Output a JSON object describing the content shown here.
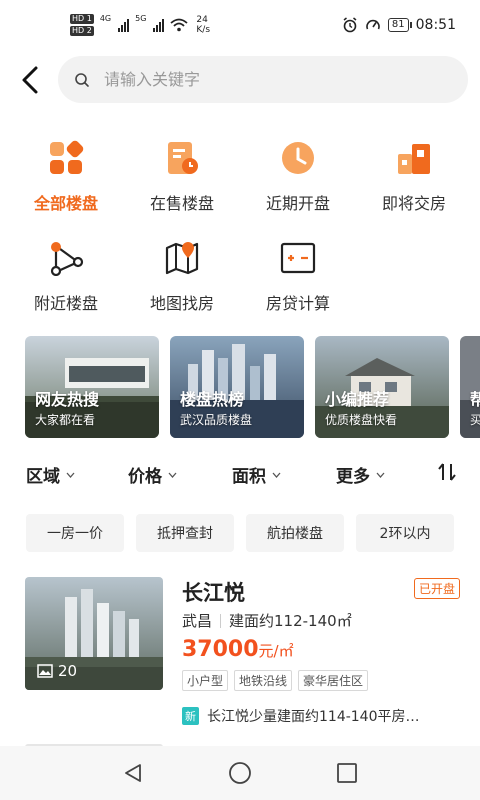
{
  "status_bar": {
    "hd1": "HD 1",
    "hd2": "HD 2",
    "net1": "4G",
    "net2": "5G",
    "speed_value": "24",
    "speed_unit": "K/s",
    "battery": "81",
    "time": "08:51"
  },
  "search": {
    "placeholder": "请输入关键字"
  },
  "categories": [
    {
      "label": "全部楼盘",
      "icon": "grid-icon",
      "active": true
    },
    {
      "label": "在售楼盘",
      "icon": "document-clock-icon",
      "active": false
    },
    {
      "label": "近期开盘",
      "icon": "clock-icon",
      "active": false
    },
    {
      "label": "即将交房",
      "icon": "buildings-icon",
      "active": false
    },
    {
      "label": "附近楼盘",
      "icon": "location-network-icon",
      "active": false
    },
    {
      "label": "地图找房",
      "icon": "map-pin-icon",
      "active": false
    },
    {
      "label": "房贷计算",
      "icon": "calculator-icon",
      "active": false
    }
  ],
  "banners": [
    {
      "title": "网友热搜",
      "subtitle": "大家都在看"
    },
    {
      "title": "楼盘热榜",
      "subtitle": "武汉品质楼盘"
    },
    {
      "title": "小编推荐",
      "subtitle": "优质楼盘快看"
    },
    {
      "title": "帮",
      "subtitle": "买"
    }
  ],
  "filters": [
    {
      "label": "区域"
    },
    {
      "label": "价格"
    },
    {
      "label": "面积"
    },
    {
      "label": "更多"
    }
  ],
  "chips": [
    "一房一价",
    "抵押查封",
    "航拍楼盘",
    "2环以内"
  ],
  "listing": {
    "name": "长江悦",
    "status": "已开盘",
    "district": "武昌",
    "area": "建面约112-140㎡",
    "price": "37000",
    "price_unit": "元/㎡",
    "tags": [
      "小户型",
      "地铁沿线",
      "豪华居住区"
    ],
    "photo_count": "20",
    "news_badge": "新",
    "news": "长江悦少量建面约114-140平房…"
  },
  "colors": {
    "accent": "#f06a1e",
    "price": "#f2511e",
    "new_badge": "#2cc1c0"
  }
}
